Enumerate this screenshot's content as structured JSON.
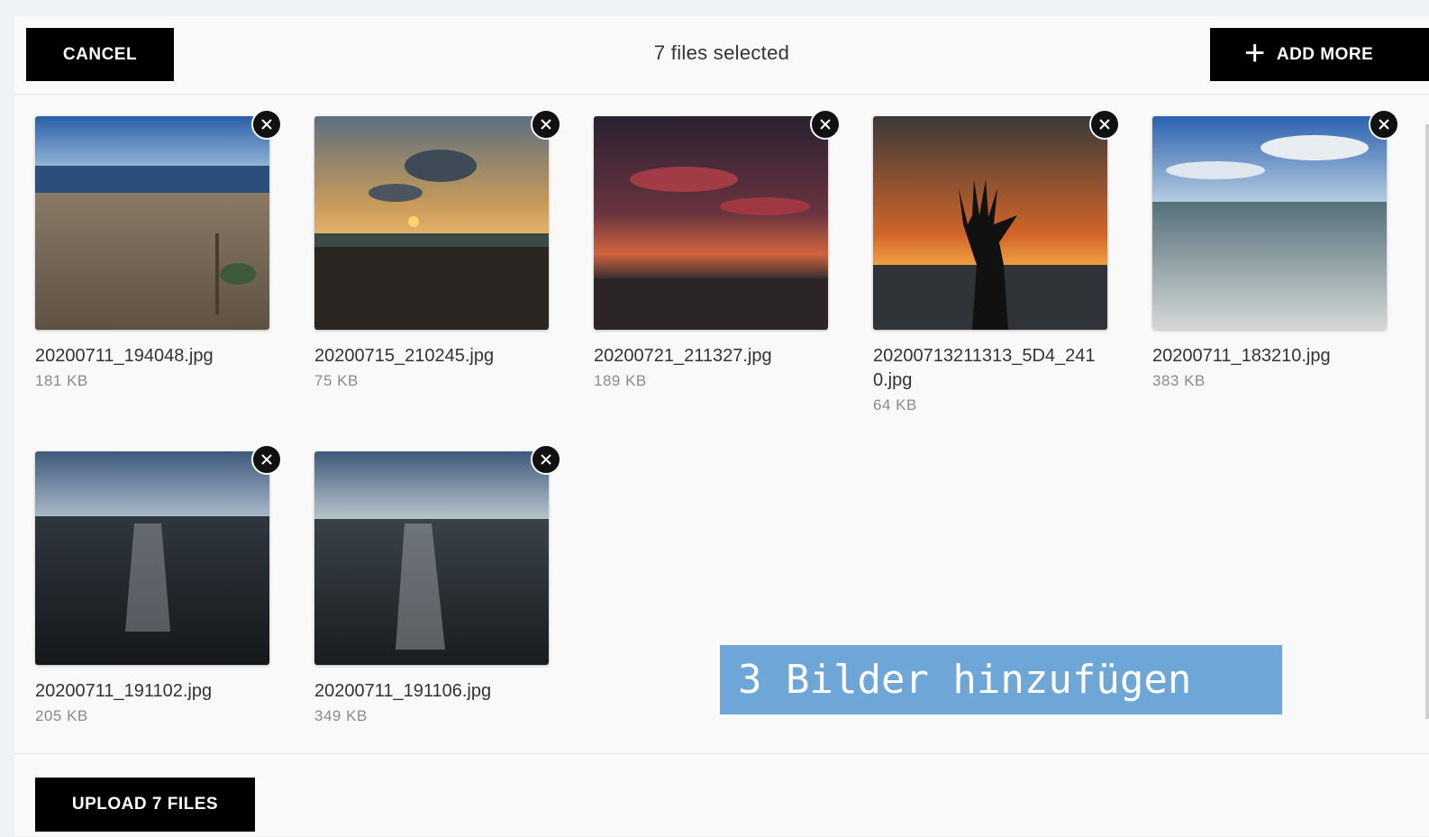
{
  "header": {
    "cancel_label": "CANCEL",
    "title": "7 files selected",
    "add_more_label": "ADD MORE"
  },
  "files": [
    {
      "name": "20200711_194048.jpg",
      "size": "181 KB"
    },
    {
      "name": "20200715_210245.jpg",
      "size": "75 KB"
    },
    {
      "name": "20200721_211327.jpg",
      "size": "189 KB"
    },
    {
      "name": "20200713211313_5D4_2410.jpg",
      "size": "64 KB"
    },
    {
      "name": "20200711_183210.jpg",
      "size": "383 KB"
    },
    {
      "name": "20200711_191102.jpg",
      "size": "205 KB"
    },
    {
      "name": "20200711_191106.jpg",
      "size": "349 KB"
    }
  ],
  "footer": {
    "upload_label": "UPLOAD 7 FILES"
  },
  "overlay": {
    "text": "3 Bilder hinzufügen"
  },
  "icons": {
    "remove": "close-icon",
    "add": "plus-icon"
  }
}
